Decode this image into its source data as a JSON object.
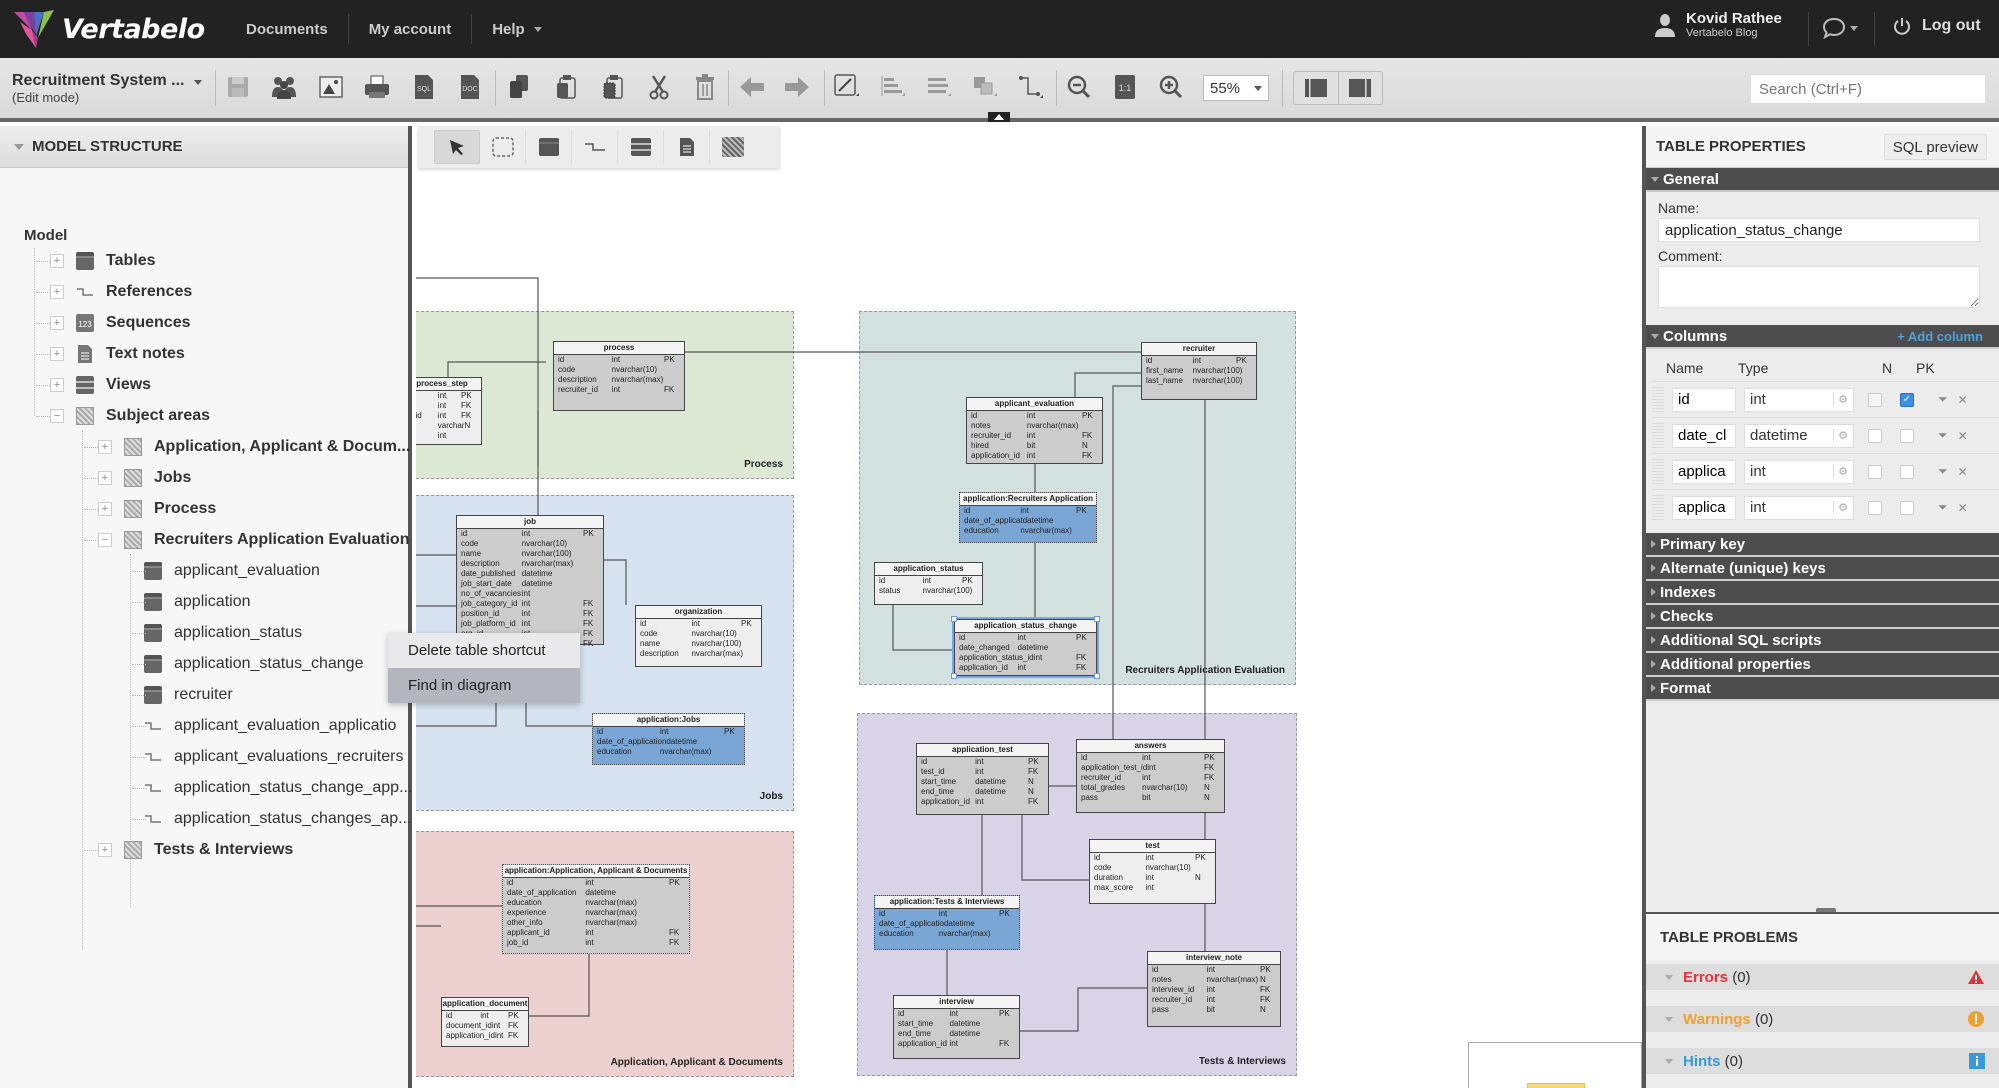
{
  "app": {
    "logo_text": "Vertabelo",
    "nav": [
      "Documents",
      "My account",
      "Help"
    ],
    "user_name": "Kovid Rathee",
    "user_org": "Vertabelo Blog",
    "logout_label": "Log out"
  },
  "toolbar": {
    "model_title": "Recruitment System ...",
    "mode": "(Edit mode)",
    "zoom_level": "55%",
    "search_placeholder": "Search (Ctrl+F)",
    "buttons": [
      "save-icon",
      "share-icon",
      "export-image-icon",
      "print-icon",
      "sql-icon",
      "doc-icon",
      "copy-icon",
      "paste-icon",
      "paste-special-icon",
      "cut-icon",
      "delete-icon",
      "undo-icon",
      "redo-icon",
      "line-style-icon",
      "align-icon",
      "distribute-icon",
      "arrange-icon",
      "reference-style-icon",
      "zoom-out-icon",
      "zoom-actual-icon",
      "zoom-in-icon"
    ]
  },
  "left_panel": {
    "title": "MODEL STRUCTURE",
    "root": "Model",
    "top_items": [
      {
        "label": "Tables",
        "icon": "table-icon"
      },
      {
        "label": "References",
        "icon": "reference-icon"
      },
      {
        "label": "Sequences",
        "icon": "sequence-icon"
      },
      {
        "label": "Text notes",
        "icon": "note-icon"
      },
      {
        "label": "Views",
        "icon": "view-icon"
      },
      {
        "label": "Subject areas",
        "icon": "subject-area-icon"
      }
    ],
    "subject_areas": [
      "Application, Applicant & Docum...",
      "Jobs",
      "Process",
      "Recruiters Application Evaluation",
      "Tests & Interviews"
    ],
    "expanded_children": [
      {
        "label": "applicant_evaluation",
        "type": "table"
      },
      {
        "label": "application",
        "type": "table"
      },
      {
        "label": "application_status",
        "type": "table"
      },
      {
        "label": "application_status_change",
        "type": "table"
      },
      {
        "label": "recruiter",
        "type": "table"
      },
      {
        "label": "applicant_evaluation_applicatio",
        "type": "reference"
      },
      {
        "label": "applicant_evaluations_recruiters",
        "type": "reference"
      },
      {
        "label": "application_status_change_app...",
        "type": "reference"
      },
      {
        "label": "application_status_changes_ap...",
        "type": "reference"
      }
    ]
  },
  "context_menu": {
    "items": [
      "Delete table shortcut",
      "Find in diagram"
    ],
    "highlighted": "Find in diagram"
  },
  "diagram": {
    "tools": [
      "select-tool",
      "area-select-tool",
      "add-table-tool",
      "add-reference-tool",
      "add-view-tool",
      "add-note-tool",
      "add-area-tool"
    ],
    "areas": [
      {
        "label": "Process",
        "color": "#dde8d4"
      },
      {
        "label": "Jobs",
        "color": "#d6e2ef"
      },
      {
        "label": "Application, Applicant & Documents",
        "color": "#eccfcf"
      },
      {
        "label": "Recruiters Application Evaluation",
        "color": "#d2e0e0"
      },
      {
        "label": "Tests & Interviews",
        "color": "#d9d3e8"
      }
    ],
    "tables": {
      "process_step": {
        "title": "process_step",
        "rows": [
          [
            "",
            "int",
            "PK"
          ],
          [
            "",
            "int",
            "FK"
          ],
          [
            "s_id",
            "int",
            "FK"
          ],
          [
            "",
            "varchar",
            "N"
          ],
          [
            "",
            "int",
            ""
          ]
        ]
      },
      "process": {
        "title": "process",
        "rows": [
          [
            "id",
            "int",
            "PK"
          ],
          [
            "code",
            "nvarchar(10)",
            ""
          ],
          [
            "description",
            "nvarchar(max)",
            ""
          ],
          [
            "recruiter_id",
            "int",
            "FK"
          ]
        ]
      },
      "job": {
        "title": "job",
        "rows": [
          [
            "id",
            "int",
            "PK"
          ],
          [
            "code",
            "nvarchar(10)",
            ""
          ],
          [
            "name",
            "nvarchar(100)",
            ""
          ],
          [
            "description",
            "nvarchar(max)",
            ""
          ],
          [
            "date_published",
            "datetime",
            ""
          ],
          [
            "job_start_date",
            "datetime",
            ""
          ],
          [
            "no_of_vacancies",
            "int",
            ""
          ],
          [
            "job_category_id",
            "int",
            "FK"
          ],
          [
            "position_id",
            "int",
            "FK"
          ],
          [
            "job_platform_id",
            "int",
            "FK"
          ],
          [
            "org_id",
            "int",
            "FK"
          ],
          [
            "",
            "",
            "FK"
          ]
        ]
      },
      "organization": {
        "title": "organization",
        "rows": [
          [
            "id",
            "int",
            "PK"
          ],
          [
            "code",
            "nvarchar(10)",
            ""
          ],
          [
            "name",
            "nvarchar(100)",
            ""
          ],
          [
            "description",
            "nvarchar(max)",
            ""
          ]
        ]
      },
      "application_jobs": {
        "title": "application:Jobs",
        "rows": [
          [
            "id",
            "int",
            "PK"
          ],
          [
            "date_of_application",
            "datetime",
            ""
          ],
          [
            "education",
            "nvarchar(max)",
            ""
          ]
        ]
      },
      "application_aad": {
        "title": "application:Application, Applicant & Documents",
        "rows": [
          [
            "id",
            "int",
            "PK"
          ],
          [
            "date_of_application",
            "datetime",
            ""
          ],
          [
            "education",
            "nvarchar(max)",
            ""
          ],
          [
            "experience",
            "nvarchar(max)",
            ""
          ],
          [
            "other_info",
            "nvarchar(max)",
            ""
          ],
          [
            "applicant_id",
            "int",
            "FK"
          ],
          [
            "job_id",
            "int",
            "FK"
          ]
        ]
      },
      "application_document": {
        "title": "application_document",
        "rows": [
          [
            "id",
            "int",
            "PK"
          ],
          [
            "document_id",
            "int",
            "FK"
          ],
          [
            "application_id",
            "int",
            "FK"
          ]
        ]
      },
      "recruiter": {
        "title": "recruiter",
        "rows": [
          [
            "id",
            "int",
            "PK"
          ],
          [
            "first_name",
            "nvarchar(100)",
            ""
          ],
          [
            "last_name",
            "nvarchar(100)",
            ""
          ]
        ]
      },
      "applicant_evaluation": {
        "title": "applicant_evaluation",
        "rows": [
          [
            "id",
            "int",
            "PK"
          ],
          [
            "notes",
            "nvarchar(max)",
            ""
          ],
          [
            "recruiter_id",
            "int",
            "FK"
          ],
          [
            "hired",
            "bit",
            "N"
          ],
          [
            "application_id",
            "int",
            "FK"
          ]
        ]
      },
      "application_rae": {
        "title": "application:Recruiters Application",
        "rows": [
          [
            "id",
            "int",
            "PK"
          ],
          [
            "date_of_applicat",
            "datetime",
            ""
          ],
          [
            "education",
            "nvarchar(max)",
            ""
          ]
        ]
      },
      "application_status": {
        "title": "application_status",
        "rows": [
          [
            "id",
            "int",
            "PK"
          ],
          [
            "status",
            "nvarchar(100)",
            ""
          ]
        ]
      },
      "application_status_change": {
        "title": "application_status_change",
        "rows": [
          [
            "id",
            "int",
            "PK"
          ],
          [
            "date_changed",
            "datetime",
            ""
          ],
          [
            "application_status_id",
            "int",
            "FK"
          ],
          [
            "application_id",
            "int",
            "FK"
          ]
        ]
      },
      "application_test": {
        "title": "application_test",
        "rows": [
          [
            "id",
            "int",
            "PK"
          ],
          [
            "test_id",
            "int",
            "FK"
          ],
          [
            "start_time",
            "datetime",
            "N"
          ],
          [
            "end_time",
            "datetime",
            "N"
          ],
          [
            "application_id",
            "int",
            "FK"
          ]
        ]
      },
      "answers": {
        "title": "answers",
        "rows": [
          [
            "id",
            "int",
            "PK"
          ],
          [
            "application_test_id",
            "int",
            "FK"
          ],
          [
            "recruiter_id",
            "int",
            "FK"
          ],
          [
            "total_grades",
            "nvarchar(10)",
            "N"
          ],
          [
            "pass",
            "bit",
            "N"
          ]
        ]
      },
      "test": {
        "title": "test",
        "rows": [
          [
            "id",
            "int",
            "PK"
          ],
          [
            "code",
            "nvarchar(10)",
            ""
          ],
          [
            "duration",
            "int",
            "N"
          ],
          [
            "max_score",
            "int",
            ""
          ]
        ]
      },
      "application_ti": {
        "title": "application:Tests & Interviews",
        "rows": [
          [
            "id",
            "int",
            "PK"
          ],
          [
            "date_of_applicatio",
            "datetime",
            ""
          ],
          [
            "education",
            "nvarchar(max)",
            ""
          ]
        ]
      },
      "interview": {
        "title": "interview",
        "rows": [
          [
            "id",
            "int",
            "PK"
          ],
          [
            "start_time",
            "datetime",
            ""
          ],
          [
            "end_time",
            "datetime",
            ""
          ],
          [
            "application_id",
            "int",
            "FK"
          ]
        ]
      },
      "interview_note": {
        "title": "interview_note",
        "rows": [
          [
            "id",
            "int",
            "PK"
          ],
          [
            "notes",
            "nvarchar(max)",
            "N"
          ],
          [
            "interview_id",
            "int",
            "FK"
          ],
          [
            "recruiter_id",
            "int",
            "FK"
          ],
          [
            "pass",
            "bit",
            "N"
          ]
        ]
      }
    }
  },
  "right_panel": {
    "title": "TABLE PROPERTIES",
    "sql_preview_label": "SQL preview",
    "general_label": "General",
    "name_label": "Name:",
    "name_value": "application_status_change",
    "comment_label": "Comment:",
    "comment_value": "",
    "columns_label": "Columns",
    "add_column_label": "+ Add column",
    "col_headers": [
      "Name",
      "Type",
      "N",
      "PK"
    ],
    "columns": [
      {
        "name": "id",
        "type": "int",
        "nullable": false,
        "pk": true
      },
      {
        "name": "date_cl",
        "type": "datetime",
        "nullable": false,
        "pk": false
      },
      {
        "name": "applica",
        "type": "int",
        "nullable": false,
        "pk": false
      },
      {
        "name": "applica",
        "type": "int",
        "nullable": false,
        "pk": false
      }
    ],
    "sections": [
      "Primary key",
      "Alternate (unique) keys",
      "Indexes",
      "Checks",
      "Additional SQL scripts",
      "Additional properties",
      "Format"
    ],
    "problems_title": "TABLE PROBLEMS",
    "problems": [
      {
        "label": "Errors",
        "count": "(0)",
        "color": "#e8303a"
      },
      {
        "label": "Warnings",
        "count": "(0)",
        "color": "#f0a030"
      },
      {
        "label": "Hints",
        "count": "(0)",
        "color": "#3a9ad9"
      }
    ]
  }
}
